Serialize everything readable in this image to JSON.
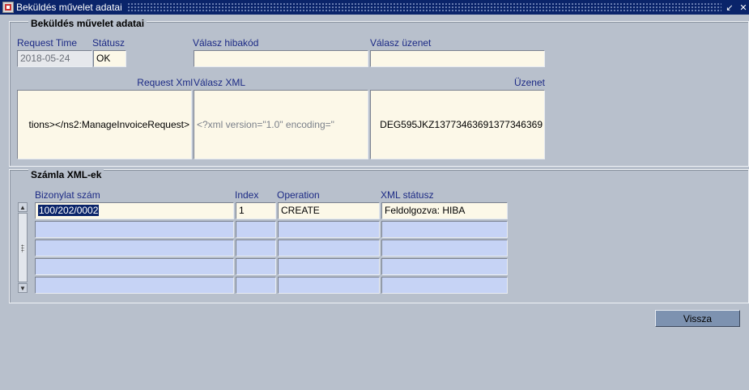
{
  "window": {
    "title": "Beküldés művelet adatai",
    "app_icon": "oracle-forms-icon",
    "restore_icon": "restore-icon",
    "close_icon": "close-icon"
  },
  "section1": {
    "title": "Beküldés művelet adatai",
    "request_time": {
      "label": "Request Time",
      "value": "2018-05-24"
    },
    "status": {
      "label": "Státusz",
      "value": "OK"
    },
    "error_code": {
      "label": "Válasz hibakód",
      "value": ""
    },
    "response_msg": {
      "label": "Válasz üzenet",
      "value": ""
    },
    "request_xml": {
      "label": "Request Xml",
      "value": "tions></ns2:ManageInvoiceRequest>"
    },
    "response_xml": {
      "label": "Válasz XML",
      "value": "<?xml version=\"1.0\" encoding=\""
    },
    "message": {
      "label": "Üzenet",
      "value": "DEG595JKZ13773463691377346369"
    }
  },
  "section2": {
    "title": "Számla XML-ek",
    "columns": [
      "Bizonylat szám",
      "Index",
      "Operation",
      "XML státusz"
    ],
    "rows": [
      [
        "100/202/0002",
        "1",
        "CREATE",
        "Feldolgozva: HIBA"
      ],
      [
        "",
        "",
        "",
        ""
      ],
      [
        "",
        "",
        "",
        ""
      ],
      [
        "",
        "",
        "",
        ""
      ],
      [
        "",
        "",
        "",
        ""
      ]
    ]
  },
  "buttons": {
    "back": "Vissza"
  }
}
